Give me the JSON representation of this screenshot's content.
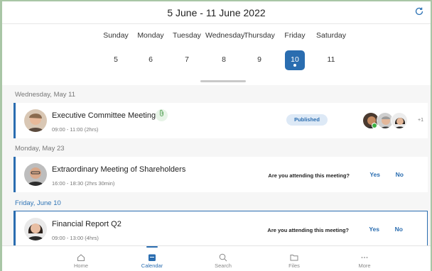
{
  "header": {
    "title": "5 June - 11 June 2022",
    "refresh_icon": "refresh-icon"
  },
  "week": {
    "days": [
      {
        "name": "Sunday",
        "num": "5"
      },
      {
        "name": "Monday",
        "num": "6"
      },
      {
        "name": "Tuesday",
        "num": "7"
      },
      {
        "name": "Wednesday",
        "num": "8"
      },
      {
        "name": "Thursday",
        "num": "9"
      },
      {
        "name": "Friday",
        "num": "10"
      },
      {
        "name": "Saturday",
        "num": "11"
      }
    ],
    "selected": "10"
  },
  "sections": [
    {
      "label": "Wednesday, May 11",
      "event": {
        "title": "Executive Committee Meeting",
        "time": "09:00 - 11:00 (2hrs)",
        "status": "Published",
        "more_attendees": "+1"
      }
    },
    {
      "label": "Monday, May 23",
      "event": {
        "title": "Extraordinary Meeting of Shareholders",
        "time": "16:00 - 18:30 (2hrs 30min)",
        "question": "Are you attending this meeting?",
        "yes": "Yes",
        "no": "No"
      }
    },
    {
      "label": "Friday, June 10",
      "event": {
        "title": "Financial Report Q2",
        "time": "09:00 - 13:00 (4hrs)",
        "question": "Are you attending this meeting?",
        "yes": "Yes",
        "no": "No"
      }
    }
  ],
  "nav": {
    "items": [
      {
        "label": "Home",
        "icon": "home-icon"
      },
      {
        "label": "Calendar",
        "icon": "calendar-icon"
      },
      {
        "label": "Search",
        "icon": "search-icon"
      },
      {
        "label": "Files",
        "icon": "folder-icon"
      },
      {
        "label": "More",
        "icon": "more-icon"
      }
    ],
    "active": "Calendar"
  },
  "colors": {
    "accent": "#2a6db0",
    "online": "#3cb043",
    "badge_bg": "#dde9f6"
  }
}
